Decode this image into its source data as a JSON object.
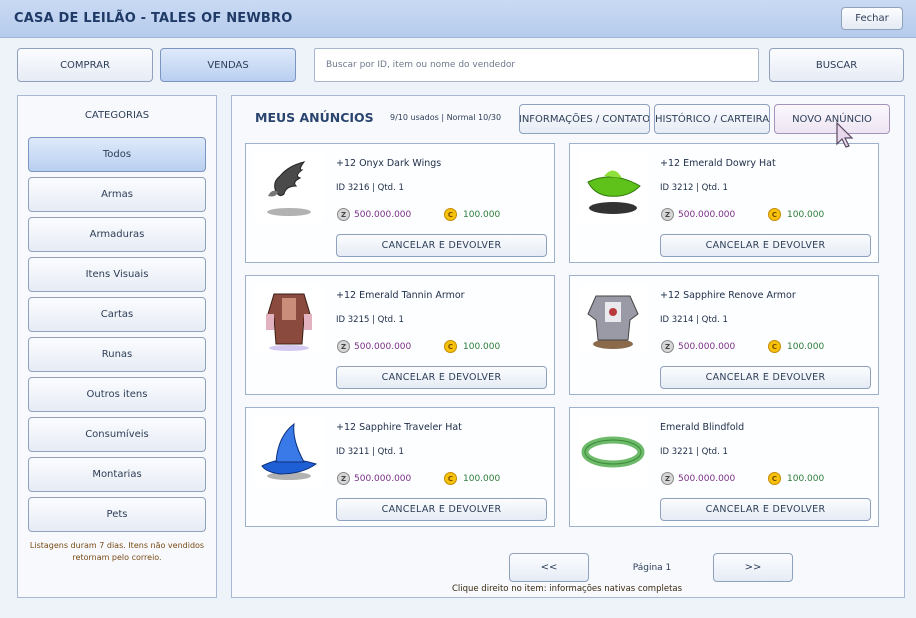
{
  "window": {
    "title": "CASA DE LEILÃO - TALES OF NEWBRO",
    "close_label": "Fechar"
  },
  "toolbar": {
    "buy_label": "COMPRAR",
    "sell_label": "VENDAS",
    "search_placeholder": "Buscar por ID, item ou nome do vendedor",
    "search_value": "",
    "search_button": "BUSCAR"
  },
  "sidebar": {
    "heading": "CATEGORIAS",
    "items": [
      {
        "label": "Todos",
        "active": true
      },
      {
        "label": "Armas"
      },
      {
        "label": "Armaduras"
      },
      {
        "label": "Itens Visuais"
      },
      {
        "label": "Cartas"
      },
      {
        "label": "Runas"
      },
      {
        "label": "Outros itens"
      },
      {
        "label": "Consumíveis"
      },
      {
        "label": "Montarias"
      },
      {
        "label": "Pets"
      }
    ],
    "note": "Listagens duram 7 dias. Itens não vendidos retornam pelo correio."
  },
  "main": {
    "title": "MEUS ANÚNCIOS",
    "usage": "9/10 usados | Normal 10/30",
    "info_button": "INFORMAÇÕES / CONTATO",
    "history_button": "HISTÓRICO / CARTEIRA",
    "new_button": "NOVO ANÚNCIO",
    "listings": [
      {
        "name": "+12 Onyx Dark Wings",
        "meta": "ID 3216  |  Qtd. 1",
        "zeny": "500.000.000",
        "cash": "100.000",
        "action": "CANCELAR E DEVOLVER",
        "icon": "dark-wings-icon",
        "color": "#4a4a4a"
      },
      {
        "name": "+12 Emerald Dowry Hat",
        "meta": "ID 3212  |  Qtd. 1",
        "zeny": "500.000.000",
        "cash": "100.000",
        "action": "CANCELAR E DEVOLVER",
        "icon": "green-hat-icon",
        "color": "#5fc21a"
      },
      {
        "name": "+12 Emerald Tannin Armor",
        "meta": "ID 3215  |  Qtd. 1",
        "zeny": "500.000.000",
        "cash": "100.000",
        "action": "CANCELAR E DEVOLVER",
        "icon": "tannin-armor-icon",
        "color": "#8a4a3e"
      },
      {
        "name": "+12 Sapphire Renove Armor",
        "meta": "ID 3214  |  Qtd. 1",
        "zeny": "500.000.000",
        "cash": "100.000",
        "action": "CANCELAR E DEVOLVER",
        "icon": "renove-armor-icon",
        "color": "#9a9aa6"
      },
      {
        "name": "+12 Sapphire Traveler Hat",
        "meta": "ID 3211  |  Qtd. 1",
        "zeny": "500.000.000",
        "cash": "100.000",
        "action": "CANCELAR E DEVOLVER",
        "icon": "blue-hat-icon",
        "color": "#1f5fd6"
      },
      {
        "name": "Emerald Blindfold",
        "meta": "ID 3221  |  Qtd. 1",
        "zeny": "500.000.000",
        "cash": "100.000",
        "action": "CANCELAR E DEVOLVER",
        "icon": "blindfold-icon",
        "color": "#6dbb6a"
      }
    ],
    "pager": {
      "prev": "<<",
      "next": ">>",
      "label": "Página 1"
    },
    "note": "Clique direito no item: informações nativas completas"
  },
  "currency_icons": {
    "zeny": "Z",
    "cash": "C"
  }
}
